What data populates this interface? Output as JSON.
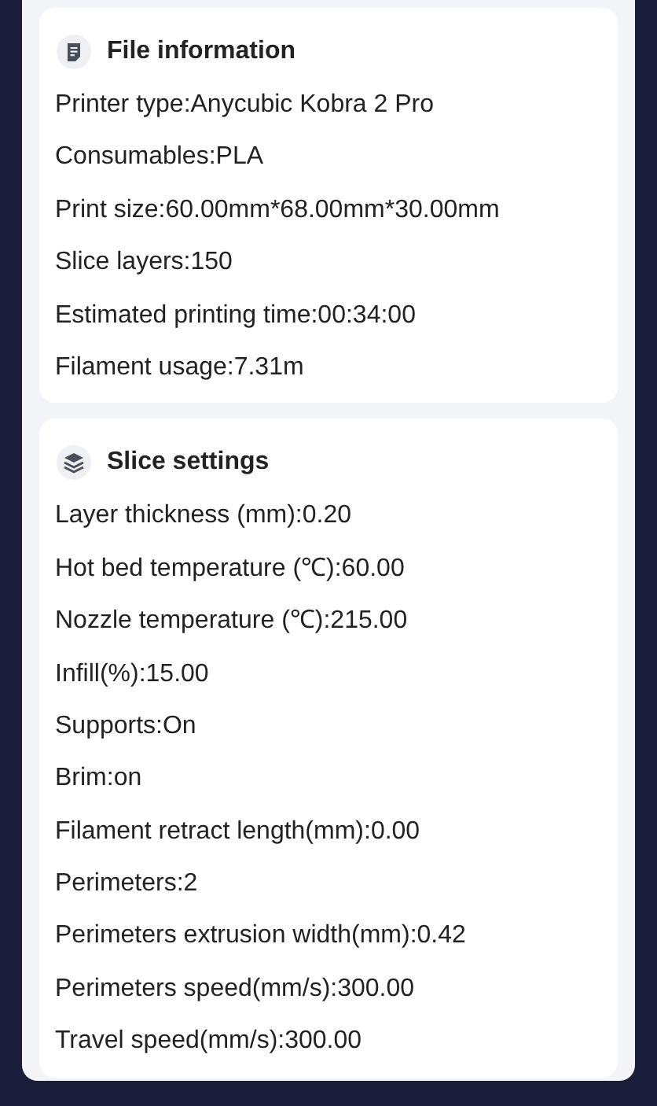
{
  "sections": [
    {
      "title": "File information",
      "rows": [
        "Printer type:Anycubic Kobra 2 Pro",
        "Consumables:PLA",
        "Print size:60.00mm*68.00mm*30.00mm",
        "Slice layers:150",
        "Estimated printing time:00:34:00",
        "Filament usage:7.31m"
      ]
    },
    {
      "title": "Slice settings",
      "rows": [
        "Layer thickness (mm):0.20",
        "Hot bed temperature (℃):60.00",
        "Nozzle temperature (℃):215.00",
        "Infill(%):15.00",
        "Supports:On",
        "Brim:on",
        "Filament retract length(mm):0.00",
        "Perimeters:2",
        "Perimeters extrusion width(mm):0.42",
        "Perimeters speed(mm/s):300.00",
        "Travel speed(mm/s):300.00"
      ]
    }
  ]
}
